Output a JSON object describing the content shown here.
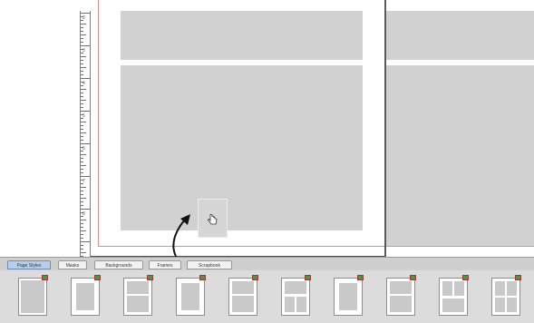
{
  "tabs": [
    {
      "label": "Page Styles",
      "active": true
    },
    {
      "label": "Masks",
      "active": false
    },
    {
      "label": "Backgrounds",
      "active": false
    },
    {
      "label": "Frames",
      "active": false
    },
    {
      "label": "Scrapbook",
      "active": false
    }
  ],
  "ruler": {
    "numbers": [
      "2",
      "3",
      "4",
      "5",
      "6",
      "7",
      "8"
    ]
  },
  "thumbnails": [
    {
      "layout": "full"
    },
    {
      "layout": "single-inset"
    },
    {
      "layout": "two-row"
    },
    {
      "layout": "single-inset"
    },
    {
      "layout": "two-row"
    },
    {
      "layout": "top-wide-two-bottom"
    },
    {
      "layout": "single-inset"
    },
    {
      "layout": "two-row"
    },
    {
      "layout": "two-top-one-bottom"
    },
    {
      "layout": "four-grid"
    }
  ],
  "icons": {
    "cursor": "hand-cursor-icon",
    "arrow": "curved-arrow-icon",
    "badge": "style-badge-icon"
  },
  "colors": {
    "placeholder": "#d1d1d1",
    "guide": "#e88a8a",
    "tab_active": "#b9cde6"
  }
}
